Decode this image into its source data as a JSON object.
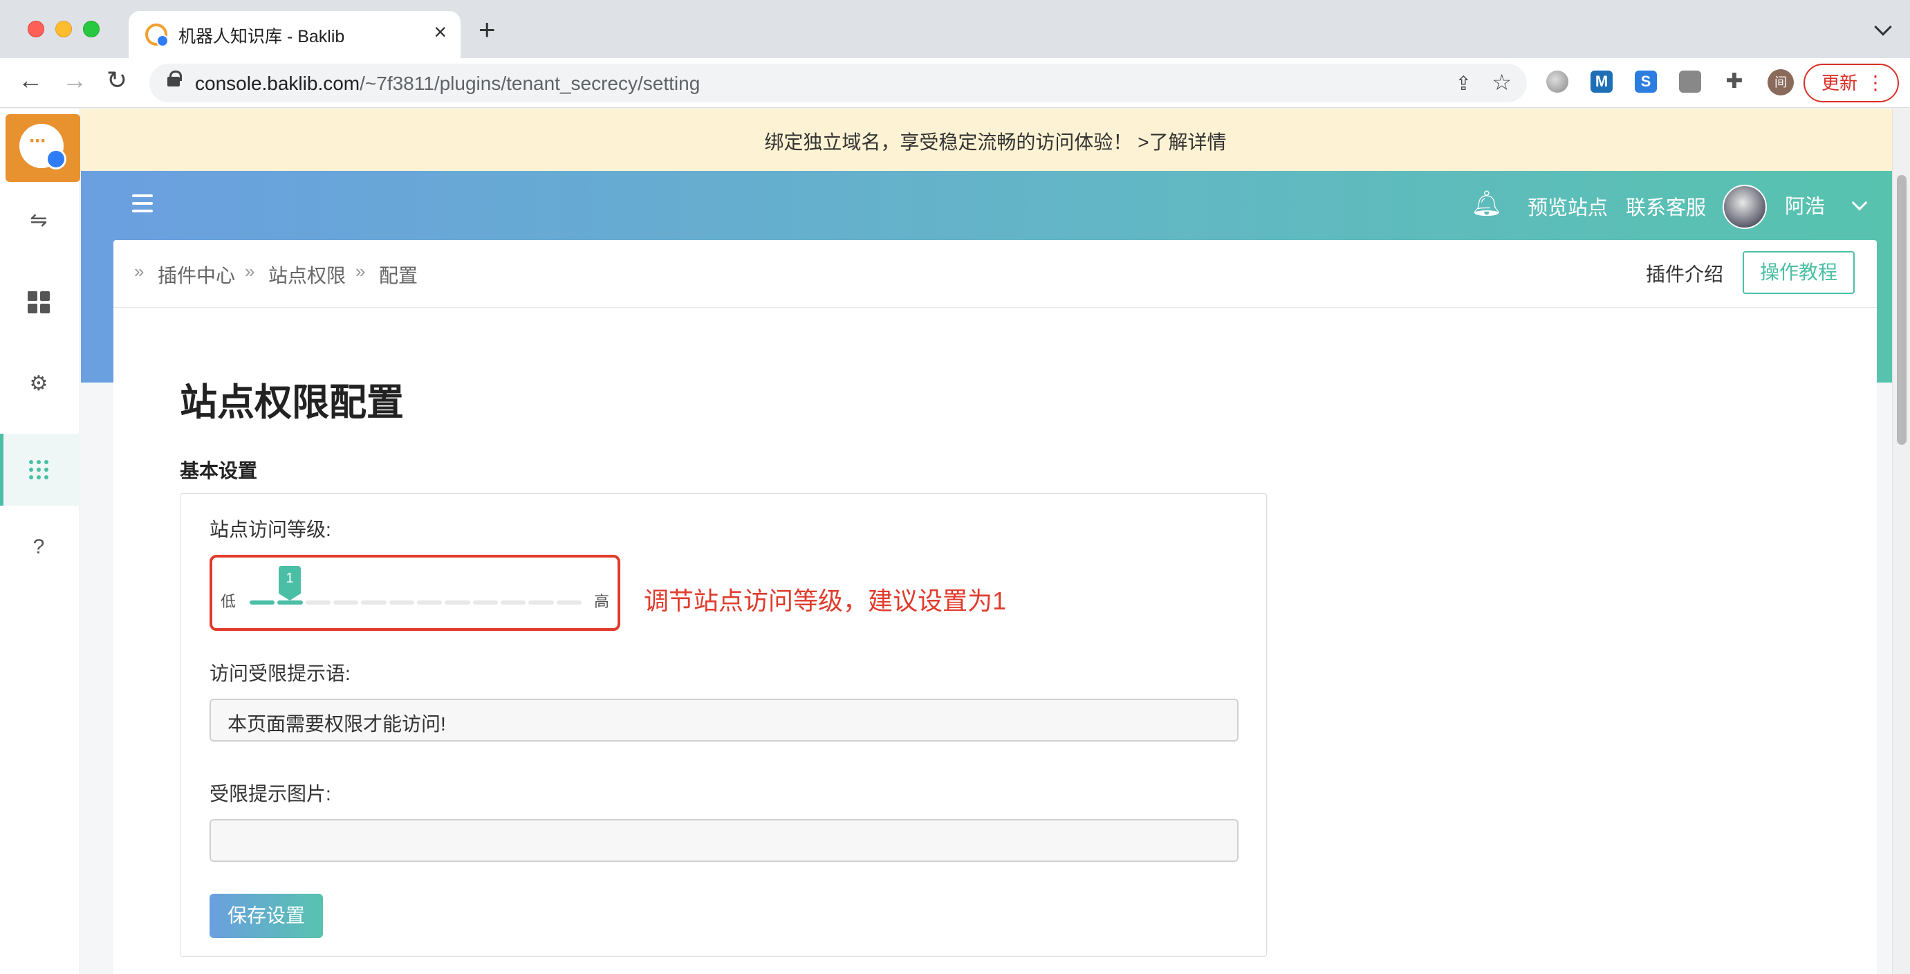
{
  "browser": {
    "tab_title": "机器人知识库 - Baklib",
    "url_host": "console.baklib.com",
    "url_path": "/~7f3811/plugins/tenant_secrecy/setting",
    "profile_initial": "间",
    "update_label": "更新",
    "extensions": [
      "globe-icon",
      "M",
      "S",
      "camera-icon",
      "puzzle-icon"
    ]
  },
  "notice": {
    "text": "绑定独立域名，享受稳定流畅的访问体验！ >了解详情"
  },
  "header": {
    "preview_site": "预览站点",
    "contact_support": "联系客服",
    "user_name": "阿浩"
  },
  "breadcrumb": [
    "插件中心",
    "站点权限",
    "配置"
  ],
  "actions": {
    "plugin_intro": "插件介绍",
    "tutorial": "操作教程"
  },
  "page": {
    "title": "站点权限配置",
    "section": "基本设置",
    "access_level_label": "站点访问等级:",
    "slider_low": "低",
    "slider_high": "高",
    "slider_value": "1",
    "slider_value_fraction": 0.1,
    "annotation": "调节站点访问等级，建议设置为1",
    "restricted_msg_label": "访问受限提示语:",
    "restricted_msg_value": "本页面需要权限才能访问!",
    "restricted_img_label": "受限提示图片:",
    "restricted_img_value": "",
    "save_label": "保存设置"
  },
  "colors": {
    "accent": "#4bbfa5",
    "gradient_start": "#6a9fe0",
    "gradient_end": "#57c3ae",
    "annotation": "#e03b2c",
    "notice_bg": "#fdf3d4"
  }
}
